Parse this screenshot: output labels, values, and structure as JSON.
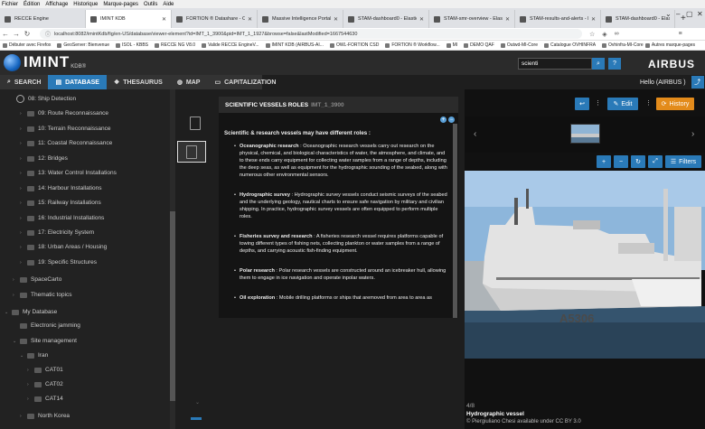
{
  "menubar": [
    "Fichier",
    "Édition",
    "Affichage",
    "Historique",
    "Marque-pages",
    "Outils",
    "Aide"
  ],
  "tabs": [
    {
      "label": "RECCE Engine"
    },
    {
      "label": "IMINT KDB"
    },
    {
      "label": "FORTION ® Datashare - OWL"
    },
    {
      "label": "Massive Intelligence Portal - C"
    },
    {
      "label": "STAM-dashboard0 - Elastic"
    },
    {
      "label": "STAM-smr-overview - Elastic"
    },
    {
      "label": "STAM-results-and-alerts - Elastic"
    },
    {
      "label": "STAM-dashboard0 - Elastic"
    }
  ],
  "address": {
    "url": "localhost:8082/imintKdb/fig/en-US/database/viewer-element?id=IMT_1_3900&pid=IMT_1_1927&browse=false&lastModified=1667544630"
  },
  "bookmarks": [
    "Débuter avec Firefox",
    "GeoServer: Bienvenue",
    "ISOL - KBBS",
    "RECCE NG V8.0",
    "Valide RECCE EngineV...",
    "IMINT KDB (AIRBUS-AI...",
    "OWL-FORTION CSD",
    "FORTION ® Workflow...",
    "MI",
    "DEMO QAF",
    "Outwd-MI-Core",
    "Catalogue OVHINFRA",
    "Ovhinfra-MI-Core"
  ],
  "bookmarks_other": "Autres marque-pages",
  "header": {
    "logo": "IMINT",
    "logo_sub": "KDB®",
    "search_value": "scienti",
    "brand": "AIRBUS"
  },
  "nav": [
    {
      "label": "SEARCH",
      "icon": "search-icon"
    },
    {
      "label": "DATABASE",
      "icon": "database-icon"
    },
    {
      "label": "THESAURUS",
      "icon": "tag-icon"
    },
    {
      "label": "MAP",
      "icon": "globe-icon"
    },
    {
      "label": "CAPITALIZATION",
      "icon": "document-icon"
    }
  ],
  "user": {
    "greeting": "Hello",
    "role": "(AIRBUS )"
  },
  "tree": {
    "items": [
      "08: Ship Detection",
      "09: Route Reconnaissance",
      "10: Terrain Reconnaissance",
      "11: Coastal Reconnaissance",
      "12: Bridges",
      "13: Water Control Installations",
      "14: Harbour Installations",
      "15: Railway Installations",
      "16: Industrial Installations",
      "17: Electricity System",
      "18: Urban Areas / Housing",
      "19: Specific Structures",
      "SpaceCarto",
      "Thematic topics",
      "My Database",
      "Electronic jamming",
      "Site management",
      "Iran",
      "CAT01",
      "CAT02",
      "CAT14",
      "North Korea"
    ]
  },
  "viewer": {
    "title": "SCIENTIFIC VESSELS ROLES",
    "id": "IMT_1_3900",
    "intro": "Scientific & research vessels may have different roles :",
    "bullets": [
      {
        "head": "Oceanographic research",
        "text": " : Oceanographic research vessels carry out research on the physical, chemical, and biological characteristics of water, the atmosphere, and climate, and to these ends carry equipment for collecting water samples from a range of depths, including the deep seas, as well as equipment for the hydrographic sounding of the seabed, along with numerous other environmental sensors."
      },
      {
        "head": "Hydrographic survey",
        "text": " : Hydrographic survey vessels conduct seismic surveys of the seabed and the underlying geology, nautical charts to ensure safe navigation by military and civilian shipping. In practice, hydrographic survey vessels are often equipped to perform multiple roles."
      },
      {
        "head": "Fisheries survey and research",
        "text": " : A fisheries research vessel requires platforms capable of towing different types of fishing nets, collecting plankton or water samples from a range of depths, and carrying acoustic fish-finding equipment."
      },
      {
        "head": "Polar research",
        "text": " : Polar research vessels are constructed around an icebreaker hull, allowing them to engage in ice navigation and operate inpolar waters."
      },
      {
        "head": "Oil exploration",
        "text": " : Mobile drilling platforms or ships that aremoved from area to area as"
      }
    ]
  },
  "right": {
    "edit_label": "Edit",
    "history_label": "History",
    "filters_label": "Filters",
    "counter": "4/8",
    "caption_title": "Hydrographic vessel",
    "caption_credit": "Piergiuliano Chesi available under CC BY 3.0",
    "hull_number": "A5306"
  }
}
